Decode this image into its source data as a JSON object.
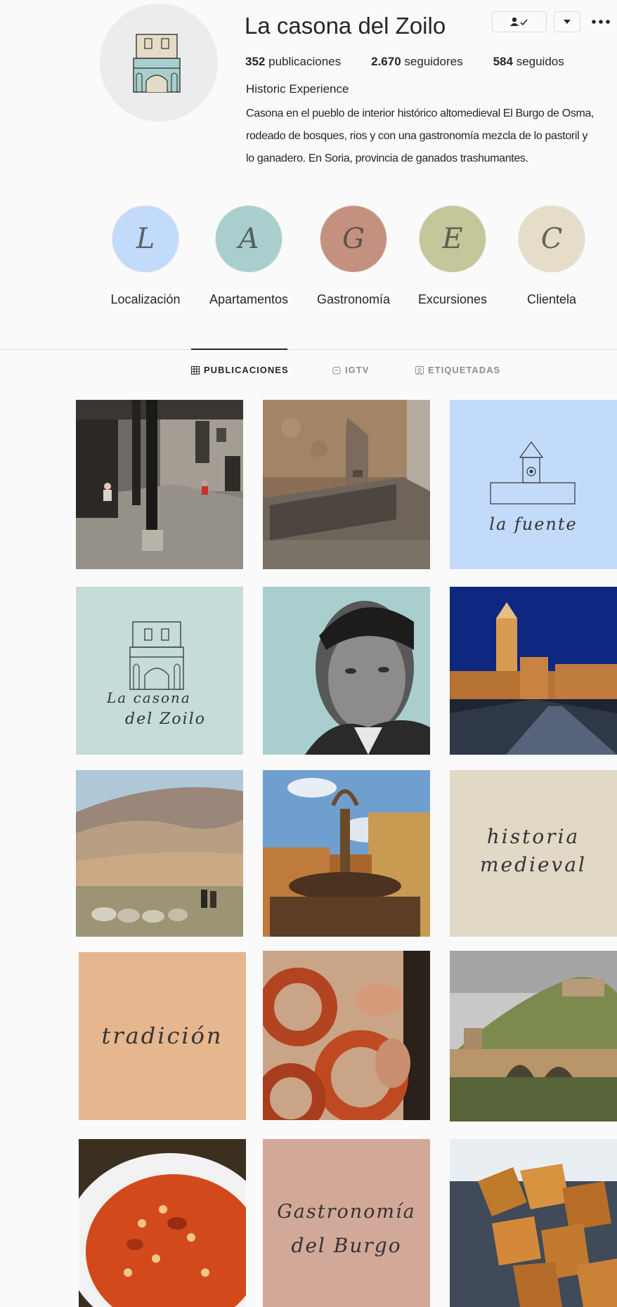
{
  "profile": {
    "username": "La casona del Zoilo",
    "avatar_icon": "house-logo-icon",
    "stats": [
      {
        "count": "352",
        "label": "publicaciones"
      },
      {
        "count": "2.670",
        "label": "seguidores"
      },
      {
        "count": "584",
        "label": "seguidos"
      }
    ],
    "bio_name": "Historic Experience",
    "bio_text": "Casona en el pueblo de interior histórico altomedieval El Burgo de Osma, rodeado de bosques, rios y con una gastronomía mezcla de lo pastoril y lo ganadero. En Soria, provincia de ganados trashumantes."
  },
  "highlights": [
    {
      "letter": "L",
      "label": "Localización",
      "color": "#c3dbfb"
    },
    {
      "letter": "A",
      "label": "Apartamentos",
      "color": "#a8cfcd"
    },
    {
      "letter": "G",
      "label": "Gastronomía",
      "color": "#c49180"
    },
    {
      "letter": "E",
      "label": "Excursiones",
      "color": "#c3c799"
    },
    {
      "letter": "C",
      "label": "Clientela",
      "color": "#e6ddc9"
    }
  ],
  "tabs": [
    {
      "label": "PUBLICACIONES",
      "icon": "grid-icon",
      "active": true
    },
    {
      "label": "IGTV",
      "icon": "tv-icon",
      "active": false
    },
    {
      "label": "ETIQUETADAS",
      "icon": "tag-icon",
      "active": false
    }
  ],
  "posts": {
    "fuente": {
      "line1": "la fuente",
      "color": "#c3dbfb"
    },
    "casona": {
      "line1": "La casona",
      "line2": "del Zoilo",
      "color": "#c5dcda"
    },
    "historia": {
      "line1": "historia",
      "line2": "medieval",
      "color": "#e1d8c6"
    },
    "tradicion": {
      "line1": "tradición",
      "color": "#e6b68e"
    },
    "gastronomia": {
      "line1": "Gastronomía",
      "line2": "del Burgo",
      "color": "#d2a898"
    }
  }
}
